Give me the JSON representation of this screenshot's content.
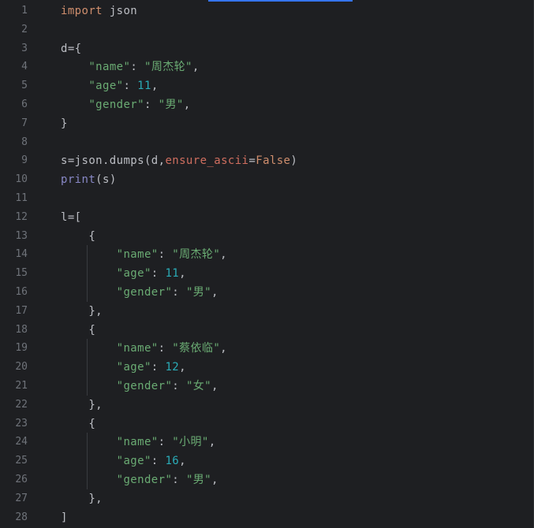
{
  "editor": {
    "lines": [
      {
        "n": "1",
        "tokens": [
          {
            "t": "import",
            "c": "kw"
          },
          {
            "t": " json",
            "c": "default"
          }
        ]
      },
      {
        "n": "2",
        "tokens": []
      },
      {
        "n": "3",
        "tokens": [
          {
            "t": "d={",
            "c": "default"
          }
        ]
      },
      {
        "n": "4",
        "tokens": [
          {
            "t": "    ",
            "c": "default"
          },
          {
            "t": "\"name\"",
            "c": "str"
          },
          {
            "t": ": ",
            "c": "default"
          },
          {
            "t": "\"周杰轮\"",
            "c": "str"
          },
          {
            "t": ",",
            "c": "default"
          }
        ]
      },
      {
        "n": "5",
        "tokens": [
          {
            "t": "    ",
            "c": "default"
          },
          {
            "t": "\"age\"",
            "c": "str"
          },
          {
            "t": ": ",
            "c": "default"
          },
          {
            "t": "11",
            "c": "num"
          },
          {
            "t": ",",
            "c": "default"
          }
        ]
      },
      {
        "n": "6",
        "tokens": [
          {
            "t": "    ",
            "c": "default"
          },
          {
            "t": "\"gender\"",
            "c": "str"
          },
          {
            "t": ": ",
            "c": "default"
          },
          {
            "t": "\"男\"",
            "c": "str"
          },
          {
            "t": ",",
            "c": "default"
          }
        ]
      },
      {
        "n": "7",
        "tokens": [
          {
            "t": "}",
            "c": "default"
          }
        ]
      },
      {
        "n": "8",
        "tokens": []
      },
      {
        "n": "9",
        "tokens": [
          {
            "t": "s=json.dumps(d,",
            "c": "default"
          },
          {
            "t": "ensure_ascii",
            "c": "param"
          },
          {
            "t": "=",
            "c": "default"
          },
          {
            "t": "False",
            "c": "const"
          },
          {
            "t": ")",
            "c": "default"
          }
        ]
      },
      {
        "n": "10",
        "tokens": [
          {
            "t": "print",
            "c": "builtin"
          },
          {
            "t": "(s)",
            "c": "default"
          }
        ]
      },
      {
        "n": "11",
        "tokens": []
      },
      {
        "n": "12",
        "tokens": [
          {
            "t": "l=[",
            "c": "default"
          }
        ]
      },
      {
        "n": "13",
        "tokens": [
          {
            "t": "    {",
            "c": "default"
          }
        ]
      },
      {
        "n": "14",
        "tokens": [
          {
            "t": "        ",
            "c": "default"
          },
          {
            "t": "\"name\"",
            "c": "str"
          },
          {
            "t": ": ",
            "c": "default"
          },
          {
            "t": "\"周杰轮\"",
            "c": "str"
          },
          {
            "t": ",",
            "c": "default"
          }
        ]
      },
      {
        "n": "15",
        "tokens": [
          {
            "t": "        ",
            "c": "default"
          },
          {
            "t": "\"age\"",
            "c": "str"
          },
          {
            "t": ": ",
            "c": "default"
          },
          {
            "t": "11",
            "c": "num"
          },
          {
            "t": ",",
            "c": "default"
          }
        ]
      },
      {
        "n": "16",
        "tokens": [
          {
            "t": "        ",
            "c": "default"
          },
          {
            "t": "\"gender\"",
            "c": "str"
          },
          {
            "t": ": ",
            "c": "default"
          },
          {
            "t": "\"男\"",
            "c": "str"
          },
          {
            "t": ",",
            "c": "default"
          }
        ]
      },
      {
        "n": "17",
        "tokens": [
          {
            "t": "    },",
            "c": "default"
          }
        ]
      },
      {
        "n": "18",
        "tokens": [
          {
            "t": "    {",
            "c": "default"
          }
        ]
      },
      {
        "n": "19",
        "tokens": [
          {
            "t": "        ",
            "c": "default"
          },
          {
            "t": "\"name\"",
            "c": "str"
          },
          {
            "t": ": ",
            "c": "default"
          },
          {
            "t": "\"蔡依临\"",
            "c": "str"
          },
          {
            "t": ",",
            "c": "default"
          }
        ]
      },
      {
        "n": "20",
        "tokens": [
          {
            "t": "        ",
            "c": "default"
          },
          {
            "t": "\"age\"",
            "c": "str"
          },
          {
            "t": ": ",
            "c": "default"
          },
          {
            "t": "12",
            "c": "num"
          },
          {
            "t": ",",
            "c": "default"
          }
        ]
      },
      {
        "n": "21",
        "tokens": [
          {
            "t": "        ",
            "c": "default"
          },
          {
            "t": "\"gender\"",
            "c": "str"
          },
          {
            "t": ": ",
            "c": "default"
          },
          {
            "t": "\"女\"",
            "c": "str"
          },
          {
            "t": ",",
            "c": "default"
          }
        ]
      },
      {
        "n": "22",
        "tokens": [
          {
            "t": "    },",
            "c": "default"
          }
        ]
      },
      {
        "n": "23",
        "tokens": [
          {
            "t": "    {",
            "c": "default"
          }
        ]
      },
      {
        "n": "24",
        "tokens": [
          {
            "t": "        ",
            "c": "default"
          },
          {
            "t": "\"name\"",
            "c": "str"
          },
          {
            "t": ": ",
            "c": "default"
          },
          {
            "t": "\"小明\"",
            "c": "str"
          },
          {
            "t": ",",
            "c": "default"
          }
        ]
      },
      {
        "n": "25",
        "tokens": [
          {
            "t": "        ",
            "c": "default"
          },
          {
            "t": "\"age\"",
            "c": "str"
          },
          {
            "t": ": ",
            "c": "default"
          },
          {
            "t": "16",
            "c": "num"
          },
          {
            "t": ",",
            "c": "default"
          }
        ]
      },
      {
        "n": "26",
        "tokens": [
          {
            "t": "        ",
            "c": "default"
          },
          {
            "t": "\"gender\"",
            "c": "str"
          },
          {
            "t": ": ",
            "c": "default"
          },
          {
            "t": "\"男\"",
            "c": "str"
          },
          {
            "t": ",",
            "c": "default"
          }
        ]
      },
      {
        "n": "27",
        "tokens": [
          {
            "t": "    },",
            "c": "default"
          }
        ]
      },
      {
        "n": "28",
        "tokens": [
          {
            "t": "]",
            "c": "default"
          }
        ]
      }
    ]
  },
  "colors": {
    "background": "#1e1f22",
    "keyword": "#cf8e6d",
    "string": "#6aab73",
    "number": "#2aacb8",
    "builtin": "#8888c6",
    "parameter": "#cf6e5f",
    "default": "#bcbec4",
    "line_number": "#6f737a",
    "accent": "#3574f0"
  }
}
